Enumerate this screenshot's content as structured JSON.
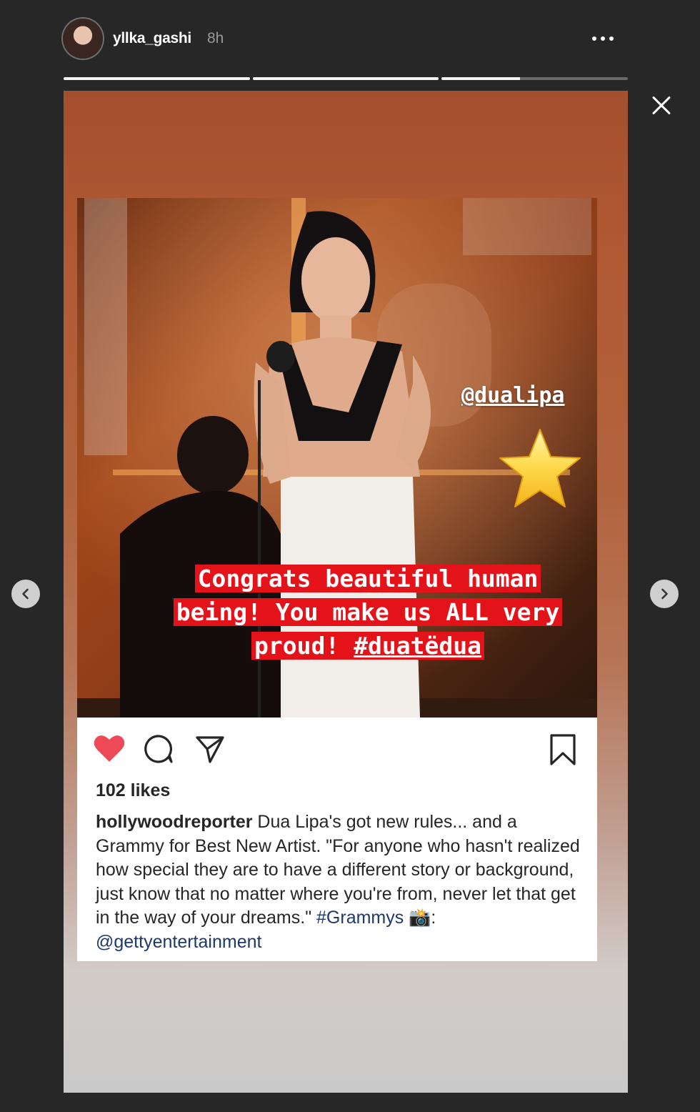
{
  "header": {
    "username": "yllka_gashi",
    "time": "8h"
  },
  "progress": [
    1,
    1,
    0.42
  ],
  "story": {
    "mention": "@dualipa",
    "star_sticker": "star-emoji",
    "caption_lines": [
      "Congrats beautiful human",
      "being! You make us ALL very",
      "proud!"
    ],
    "caption_hashtag": "#duatëdua"
  },
  "post": {
    "likes": "102 likes",
    "author": "hollywoodreporter",
    "caption_text": " Dua Lipa's got new rules... and a Grammy for Best New Artist. \"For anyone who hasn't realized how special they are to have a different story or background, just know that no matter where you're from, never let that get in the way of your dreams.\" ",
    "hashtag": "#Grammys",
    "camera_emoji": "📸",
    "credit_prefix": ": ",
    "credit": "@gettyentertainment"
  },
  "colors": {
    "heart": "#ed4956",
    "caption_bg": "#e4131a",
    "link": "#1b3a6b"
  },
  "icons": [
    "more-icon",
    "close-icon",
    "chevron-left-icon",
    "chevron-right-icon",
    "heart-icon",
    "comment-icon",
    "share-icon",
    "bookmark-icon"
  ]
}
